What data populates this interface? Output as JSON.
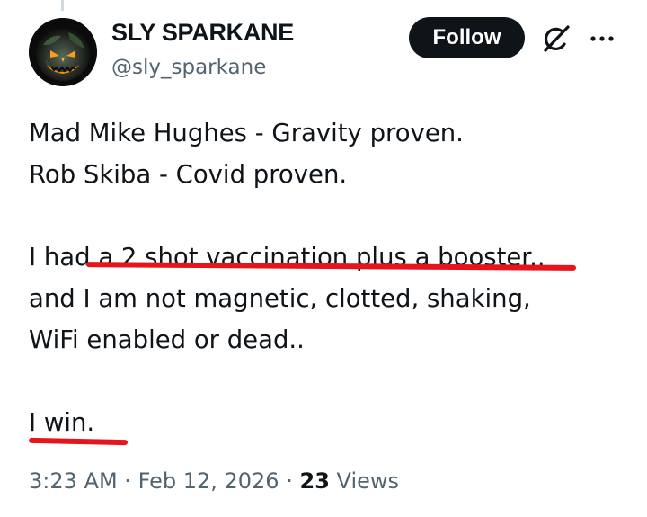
{
  "tweet": {
    "author": {
      "display_name": "SLY SPARKANE",
      "handle": "@sly_sparkane",
      "avatar_icon": "jack-o-lantern-earth-avatar"
    },
    "actions": {
      "follow_label": "Follow",
      "grok_icon": "grok-icon",
      "more_icon": "more-options-icon"
    },
    "text_lines": [
      "Mad Mike Hughes - Gravity proven.",
      "Rob Skiba - Covid proven.",
      "",
      "I had a 2 shot vaccination plus a booster..",
      "and I am not magnetic, clotted, shaking,",
      "WiFi enabled or dead..",
      "",
      "I win."
    ],
    "annotations": {
      "underline_color": "#e8141c"
    },
    "meta": {
      "time": "3:23 AM",
      "separator": "·",
      "date": "Feb 12, 2026",
      "views_count": "23",
      "views_label": "Views"
    }
  },
  "colors": {
    "text": "#0f1419",
    "secondary_text": "#536471",
    "follow_bg": "#0f1419",
    "follow_text": "#ffffff"
  }
}
